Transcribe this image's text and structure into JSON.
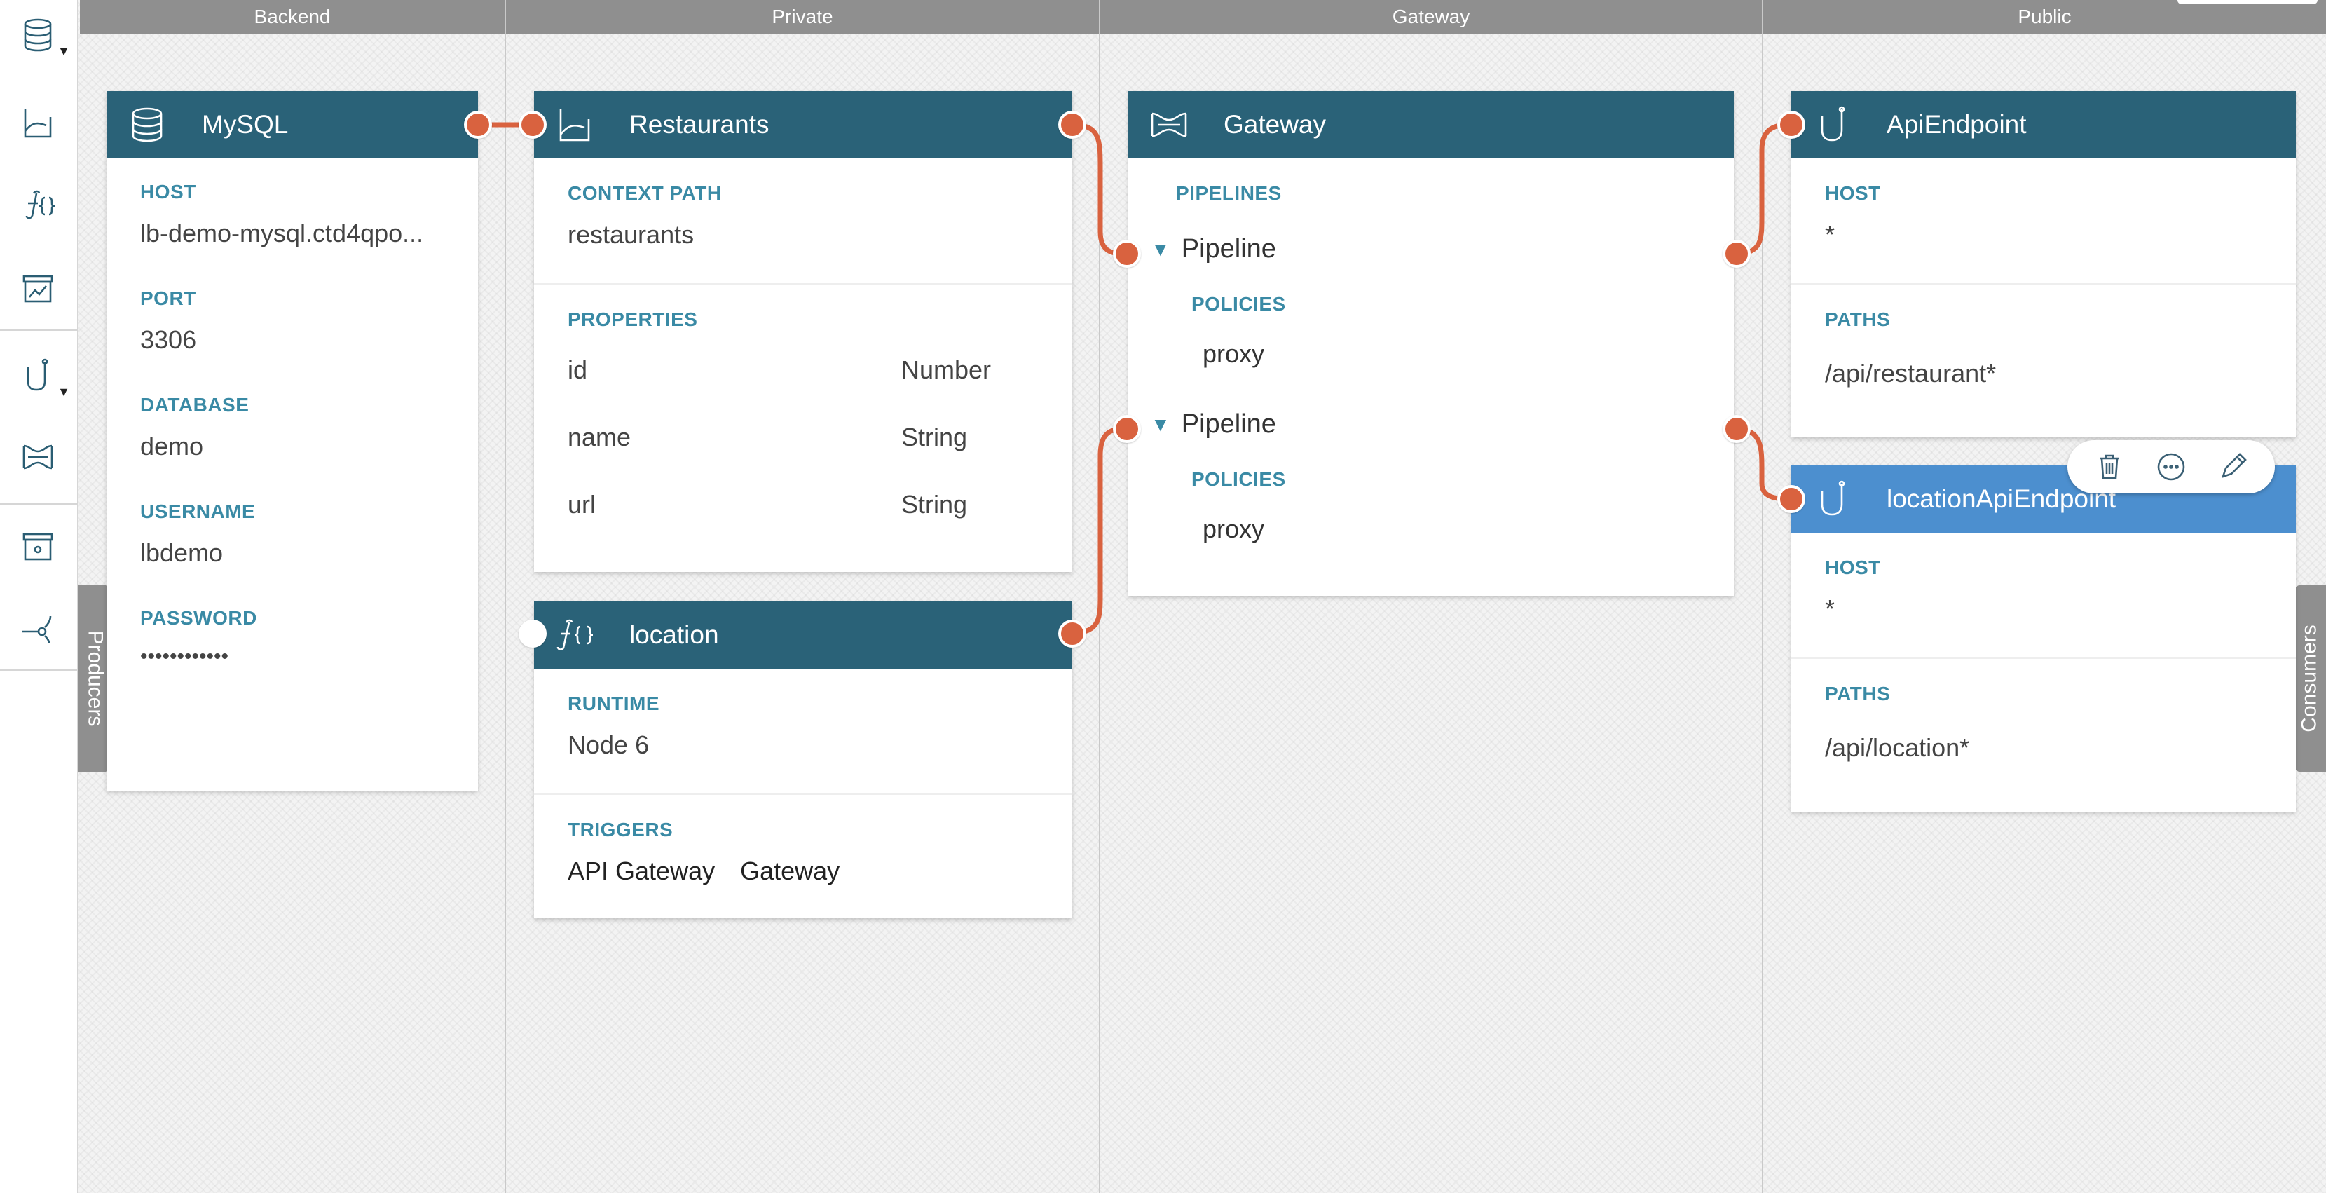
{
  "lanes": [
    "Backend",
    "Private",
    "Gateway",
    "Public"
  ],
  "side_tabs": {
    "left": "Producers",
    "right": "Consumers"
  },
  "toolbar": [
    {
      "icon": "database-icon",
      "has_menu": true
    },
    {
      "icon": "model-icon",
      "has_menu": false
    },
    {
      "icon": "function-icon",
      "has_menu": false
    },
    {
      "icon": "chart-box-icon",
      "has_menu": false
    },
    {
      "icon": "api-endpoint-icon",
      "has_menu": true
    },
    {
      "icon": "gateway-icon",
      "has_menu": false
    },
    {
      "icon": "storage-box-icon",
      "has_menu": false
    },
    {
      "icon": "connector-icon",
      "has_menu": false
    }
  ],
  "cards": {
    "mysql": {
      "title": "MySQL",
      "fields": [
        {
          "label": "HOST",
          "value": "lb-demo-mysql.ctd4qpo..."
        },
        {
          "label": "PORT",
          "value": "3306"
        },
        {
          "label": "DATABASE",
          "value": "demo"
        },
        {
          "label": "USERNAME",
          "value": "lbdemo"
        },
        {
          "label": "PASSWORD",
          "value": "••••••••••••"
        }
      ]
    },
    "restaurants": {
      "title": "Restaurants",
      "context_label": "CONTEXT PATH",
      "context_value": "restaurants",
      "properties_label": "PROPERTIES",
      "properties": [
        {
          "name": "id",
          "type": "Number"
        },
        {
          "name": "name",
          "type": "String"
        },
        {
          "name": "url",
          "type": "String"
        }
      ]
    },
    "location": {
      "title": "location",
      "runtime_label": "RUNTIME",
      "runtime_value": "Node 6",
      "triggers_label": "TRIGGERS",
      "triggers": [
        "API Gateway",
        "Gateway"
      ]
    },
    "gateway": {
      "title": "Gateway",
      "pipelines_label": "PIPELINES",
      "pipelines": [
        {
          "name": "Pipeline",
          "policies_label": "POLICIES",
          "policy": "proxy"
        },
        {
          "name": "Pipeline",
          "policies_label": "POLICIES",
          "policy": "proxy"
        }
      ]
    },
    "api_endpoint": {
      "title": "ApiEndpoint",
      "host_label": "HOST",
      "host_value": "*",
      "paths_label": "PATHS",
      "paths_value": "/api/restaurant*"
    },
    "location_api_endpoint": {
      "title": "locationApiEndpoint",
      "host_label": "HOST",
      "host_value": "*",
      "paths_label": "PATHS",
      "paths_value": "/api/location*"
    }
  },
  "colors": {
    "card_header": "#2a6278",
    "card_header_selected": "#4c8fcf",
    "label": "#3a8aa5",
    "port": "#d9623f",
    "lane_header": "#8f8f8f"
  }
}
